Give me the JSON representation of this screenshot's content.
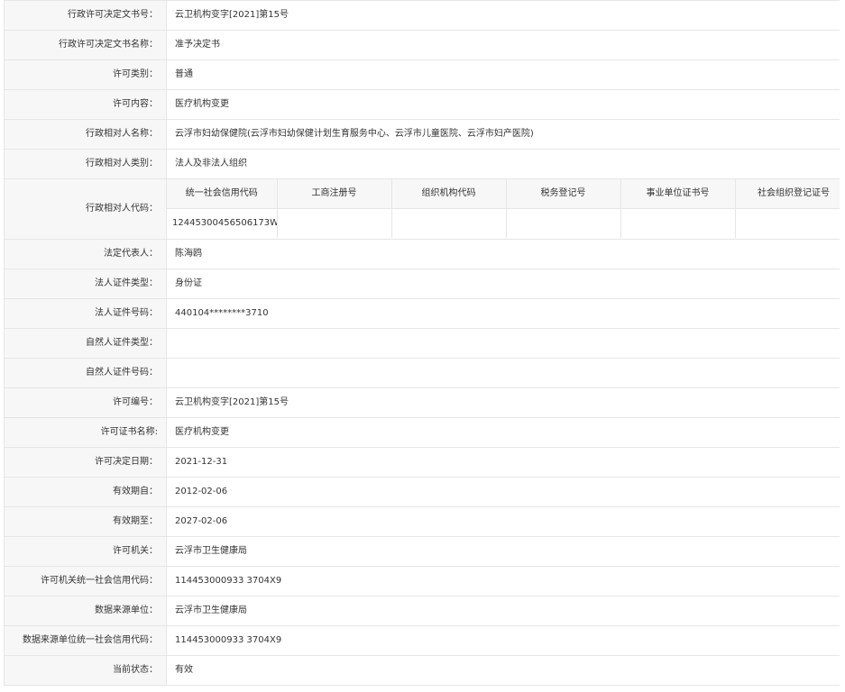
{
  "record": {
    "decision_doc_no": {
      "label": "行政许可决定文书号：",
      "value": "云卫机构变字[2021]第15号"
    },
    "decision_doc_name": {
      "label": "行政许可决定文书名称：",
      "value": "准予决定书"
    },
    "license_category": {
      "label": "许可类别：",
      "value": "普通"
    },
    "license_content": {
      "label": "许可内容：",
      "value": "医疗机构变更"
    },
    "counterpart_name": {
      "label": "行政相对人名称：",
      "value": "云浮市妇幼保健院(云浮市妇幼保健计划生育服务中心、云浮市儿童医院、云浮市妇产医院)"
    },
    "counterpart_type": {
      "label": "行政相对人类别：",
      "value": "法人及非法人组织"
    },
    "counterpart_code": {
      "label": "行政相对人代码：",
      "headers": [
        "统一社会信用代码",
        "工商注册号",
        "组织机构代码",
        "税务登记号",
        "事业单位证书号",
        "社会组织登记证号"
      ],
      "values": [
        "12445300456506173W",
        "",
        "",
        "",
        "",
        ""
      ]
    },
    "legal_rep": {
      "label": "法定代表人：",
      "value": "陈海鸥"
    },
    "legal_rep_id_type": {
      "label": "法人证件类型：",
      "value": "身份证"
    },
    "legal_rep_id_no": {
      "label": "法人证件号码：",
      "value": "440104********3710"
    },
    "natural_person_id_type": {
      "label": "自然人证件类型：",
      "value": ""
    },
    "natural_person_id_no": {
      "label": "自然人证件号码：",
      "value": ""
    },
    "license_no": {
      "label": "许可编号：",
      "value": "云卫机构变字[2021]第15号"
    },
    "certificate_name": {
      "label": "许可证书名称:",
      "value": "医疗机构变更"
    },
    "decision_date": {
      "label": "许可决定日期：",
      "value": "2021-12-31"
    },
    "valid_from": {
      "label": "有效期自：",
      "value": "2012-02-06"
    },
    "valid_to": {
      "label": "有效期至：",
      "value": "2027-02-06"
    },
    "authority": {
      "label": "许可机关：",
      "value": "云浮市卫生健康局"
    },
    "authority_credit_code": {
      "label": "许可机关统一社会信用代码：",
      "value": "114453000933 3704X9"
    },
    "data_source": {
      "label": "数据来源单位：",
      "value": "云浮市卫生健康局"
    },
    "data_source_credit_code": {
      "label": "数据来源单位统一社会信用代码：",
      "value": "114453000933 3704X9"
    },
    "status": {
      "label": "当前状态：",
      "value": "有效"
    }
  }
}
